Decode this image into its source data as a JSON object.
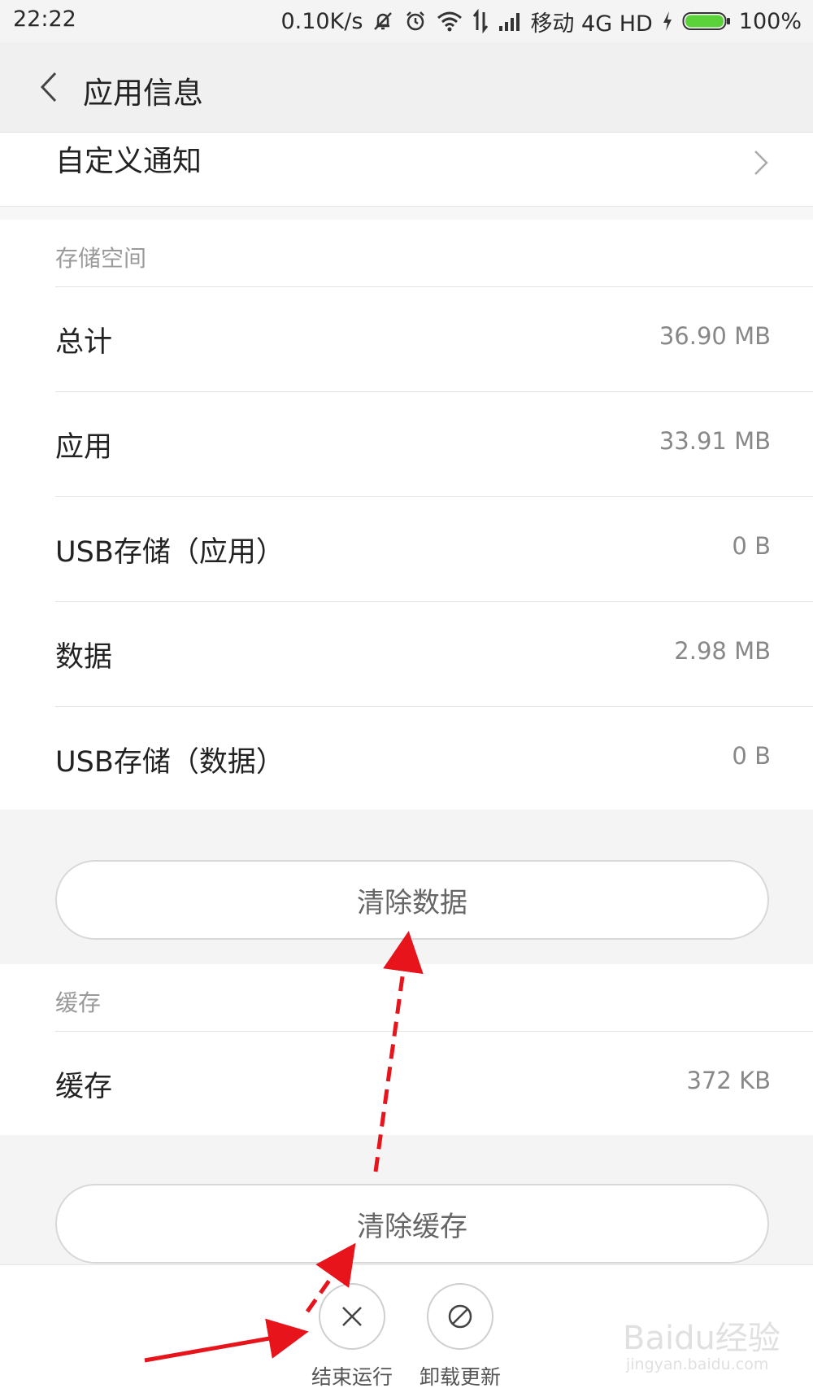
{
  "status_bar": {
    "time": "22:22",
    "net_speed": "0.10K/s",
    "carrier": "移动 4G HD",
    "battery": "100%"
  },
  "header": {
    "title": "应用信息"
  },
  "custom_notify": {
    "label": "自定义通知"
  },
  "storage": {
    "header": "存储空间",
    "rows": [
      {
        "label": "总计",
        "value": "36.90 MB"
      },
      {
        "label": "应用",
        "value": "33.91 MB"
      },
      {
        "label": "USB存储（应用）",
        "value": "0 B"
      },
      {
        "label": "数据",
        "value": "2.98 MB"
      },
      {
        "label": "USB存储（数据）",
        "value": "0 B"
      }
    ],
    "clear_button": "清除数据"
  },
  "cache": {
    "header": "缓存",
    "rows": [
      {
        "label": "缓存",
        "value": "372 KB"
      }
    ],
    "clear_button": "清除缓存"
  },
  "bottom_actions": [
    {
      "label": "结束运行",
      "icon": "close-icon"
    },
    {
      "label": "卸载更新",
      "icon": "block-icon"
    }
  ],
  "watermark": {
    "brand": "Baidu经验",
    "url": "jingyan.baidu.com"
  },
  "colors": {
    "battery_fill": "#5bd23a",
    "annotation_arrow": "#e8141b"
  }
}
